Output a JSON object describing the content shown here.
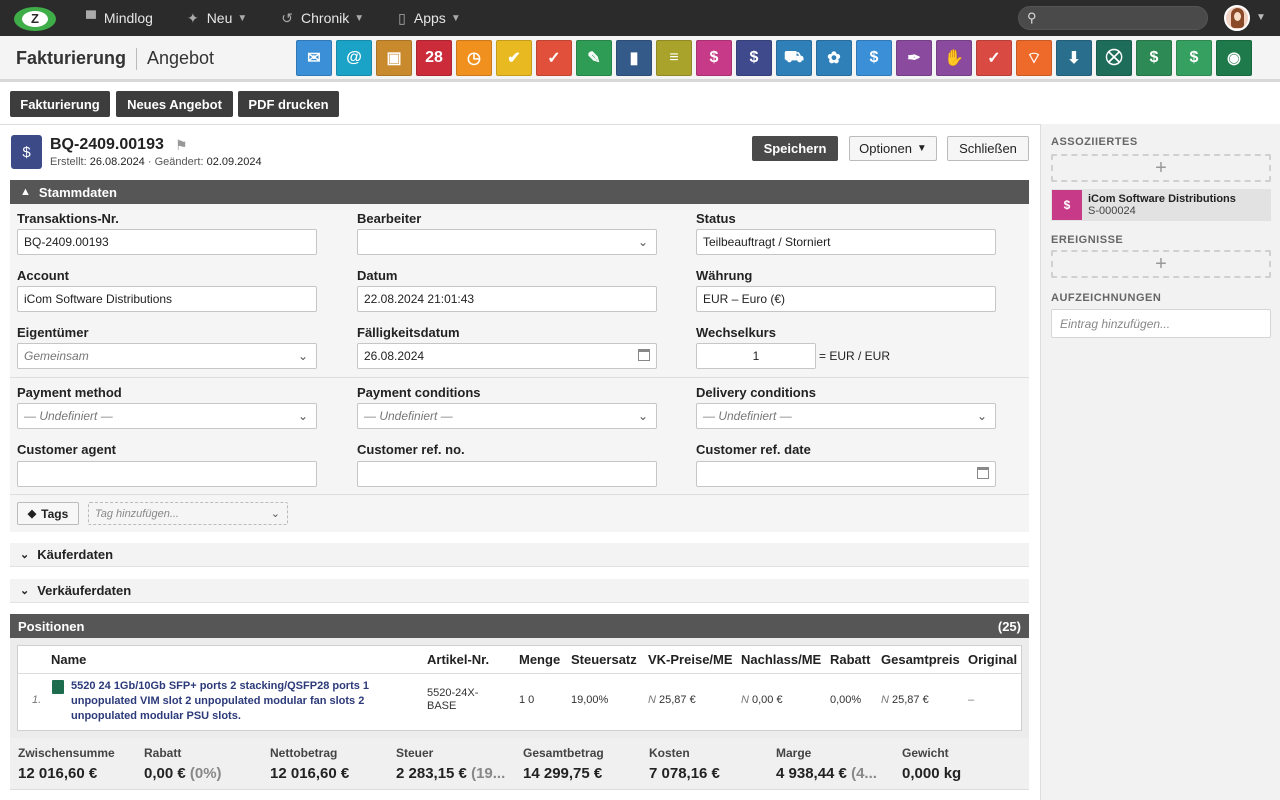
{
  "topbar": {
    "nav": [
      {
        "label": "Mindlog",
        "icon": "chat-icon"
      },
      {
        "label": "Neu",
        "icon": "sparkle-icon"
      },
      {
        "label": "Chronik",
        "icon": "history-icon"
      },
      {
        "label": "Apps",
        "icon": "tablet-icon"
      }
    ],
    "search_placeholder": ""
  },
  "module": {
    "title": "Fakturierung",
    "subtitle": "Angebot",
    "apps": [
      {
        "name": "mail-app",
        "color": "#3a8fd6",
        "glyph": "✉"
      },
      {
        "name": "email-app",
        "color": "#1aa3c7",
        "glyph": "@"
      },
      {
        "name": "contacts-app",
        "color": "#c98a2e",
        "glyph": "▣"
      },
      {
        "name": "calendar-app",
        "color": "#cc2b3a",
        "glyph": "28"
      },
      {
        "name": "timer-app",
        "color": "#f0901e",
        "glyph": "◷"
      },
      {
        "name": "tasks-app",
        "color": "#e8b920",
        "glyph": "✔"
      },
      {
        "name": "projects-app",
        "color": "#e1503a",
        "glyph": "✓"
      },
      {
        "name": "notes-app",
        "color": "#2e9c55",
        "glyph": "✎"
      },
      {
        "name": "bookmarks-app",
        "color": "#345a8a",
        "glyph": "▮"
      },
      {
        "name": "documents-app",
        "color": "#a9a32c",
        "glyph": "≡"
      },
      {
        "name": "crm-app",
        "color": "#c63a87",
        "glyph": "$"
      },
      {
        "name": "sales-app",
        "color": "#3f4a8c",
        "glyph": "$"
      },
      {
        "name": "delivery-app",
        "color": "#2f7fb8",
        "glyph": "⛟"
      },
      {
        "name": "support-app",
        "color": "#2f7fb8",
        "glyph": "✿"
      },
      {
        "name": "funds-app",
        "color": "#3a8fd6",
        "glyph": "$"
      },
      {
        "name": "legal-app",
        "color": "#8a4a9e",
        "glyph": "✒"
      },
      {
        "name": "deals-app",
        "color": "#8a4a9e",
        "glyph": "✋"
      },
      {
        "name": "contracts-app",
        "color": "#d94a42",
        "glyph": "✓"
      },
      {
        "name": "broadcast-app",
        "color": "#ee6a2a",
        "glyph": "⌔"
      },
      {
        "name": "download-app",
        "color": "#2a6e8e",
        "glyph": "⬇"
      },
      {
        "name": "cart-app",
        "color": "#1e6c5a",
        "glyph": "⛒"
      },
      {
        "name": "finance-app",
        "color": "#2e8a55",
        "glyph": "$"
      },
      {
        "name": "pricing-app",
        "color": "#35a060",
        "glyph": "$"
      },
      {
        "name": "database-app",
        "color": "#1e7a4a",
        "glyph": "◉"
      }
    ]
  },
  "actions": {
    "billing": "Fakturierung",
    "new_quote": "Neues Angebot",
    "print_pdf": "PDF drucken"
  },
  "record": {
    "number": "BQ-2409.00193",
    "created_label": "Erstellt:",
    "created": "26.08.2024",
    "changed_label": "· Geändert:",
    "changed": "02.09.2024",
    "save": "Speichern",
    "options": "Optionen",
    "close": "Schließen"
  },
  "stammdaten": {
    "title": "Stammdaten",
    "transaction_label": "Transaktions-Nr.",
    "transaction_value": "BQ-2409.00193",
    "editor_label": "Bearbeiter",
    "editor_value": "",
    "status_label": "Status",
    "status_value": "Teilbeauftragt / Storniert",
    "account_label": "Account",
    "account_value": "iCom Software Distributions",
    "date_label": "Datum",
    "date_value": "22.08.2024 21:01:43",
    "currency_label": "Währung",
    "currency_value": "EUR – Euro (€)",
    "owner_label": "Eigentümer",
    "owner_value": "Gemeinsam",
    "due_label": "Fälligkeitsdatum",
    "due_value": "26.08.2024",
    "rate_label": "Wechselkurs",
    "rate_value": "1",
    "rate_unit": "= EUR / EUR",
    "payment_method_label": "Payment method",
    "payment_method_value": "— Undefiniert —",
    "payment_conditions_label": "Payment conditions",
    "payment_conditions_value": "— Undefiniert —",
    "delivery_conditions_label": "Delivery conditions",
    "delivery_conditions_value": "— Undefiniert —",
    "customer_agent_label": "Customer agent",
    "customer_ref_no_label": "Customer ref. no.",
    "customer_ref_date_label": "Customer ref. date",
    "tags_label": "Tags",
    "tags_placeholder": "Tag hinzufügen..."
  },
  "sections": {
    "buyer": "Käuferdaten",
    "seller": "Verkäuferdaten"
  },
  "positions": {
    "title": "Positionen",
    "count": "(25)",
    "columns": [
      "Name",
      "Artikel-Nr.",
      "Menge",
      "Steuersatz",
      "VK-Preise/ME",
      "Nachlass/ME",
      "Rabatt",
      "Gesamtpreis",
      "Original"
    ],
    "rows": [
      {
        "index": "1.",
        "name": "5520 24 1Gb/10Gb SFP+ ports 2 stacking/QSFP28 ports 1 unpopulated VIM slot 2 unpopulated modular fan slots 2 unpopulated modular PSU slots.",
        "article": "5520-24X-BASE",
        "qty": "1 0",
        "tax": "19,00%",
        "price_prefix": "N",
        "price": "25,87 €",
        "discount_prefix": "N",
        "discount": "0,00 €",
        "rebate": "0,00%",
        "total_prefix": "N",
        "total": "25,87 €",
        "original": "–"
      }
    ]
  },
  "totals": [
    {
      "label": "Zwischensumme",
      "value": "12 016,60 €",
      "extra": ""
    },
    {
      "label": "Rabatt",
      "value": "0,00 €",
      "extra": " (0%)"
    },
    {
      "label": "Nettobetrag",
      "value": "12 016,60 €",
      "extra": ""
    },
    {
      "label": "Steuer",
      "value": "2 283,15 €",
      "extra": " (19..."
    },
    {
      "label": "Gesamtbetrag",
      "value": "14 299,75 €",
      "extra": ""
    },
    {
      "label": "Kosten",
      "value": "7 078,16 €",
      "extra": ""
    },
    {
      "label": "Marge",
      "value": "4 938,44 €",
      "extra": " (4..."
    },
    {
      "label": "Gewicht",
      "value": "0,000 kg",
      "extra": ""
    }
  ],
  "sidebar": {
    "associated_title": "ASSOZIIERTES",
    "associated_item_name": "iCom Software Distributions",
    "associated_item_code": "S-000024",
    "events_title": "EREIGNISSE",
    "records_title": "AUFZEICHNUNGEN",
    "records_placeholder": "Eintrag hinzufügen..."
  }
}
